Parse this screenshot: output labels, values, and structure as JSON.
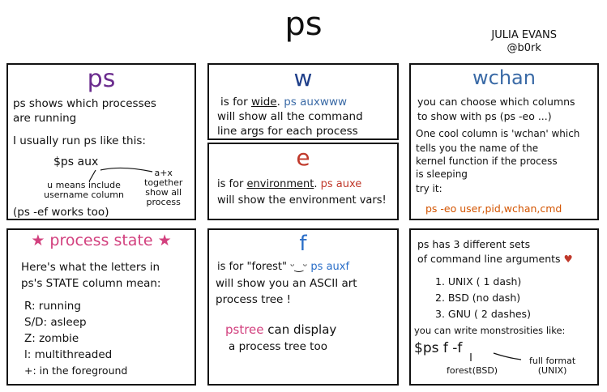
{
  "title": "ps",
  "author": {
    "name": "JULIA EVANS",
    "handle": "@b0rk"
  },
  "colors": {
    "purple": "#6b2c8e",
    "navy": "#1f3f8a",
    "red": "#c0392b",
    "pink": "#d2407e",
    "blue": "#2a6ec8",
    "orange": "#d35400"
  },
  "panel_ps": {
    "title": "ps",
    "line1": "ps shows which processes",
    "line2": "are running",
    "line3": "I usually run ps like this:",
    "command": "$ps aux",
    "note_u_1": "u means include",
    "note_u_2": "username column",
    "note_ax_1": "a+x",
    "note_ax_2": "together",
    "note_ax_3": "show all",
    "note_ax_4": "process",
    "footer": "(ps -ef works too)"
  },
  "panel_w": {
    "title": "w",
    "line1_pre": "is for ",
    "line1_word": "wide",
    "line1_post": ".",
    "line1_cmd": "ps auxwww",
    "line2": "will show all the command",
    "line3": "line args for each process"
  },
  "panel_e": {
    "title": "e",
    "line1_pre": "is for ",
    "line1_word": "environment",
    "line1_post": ".",
    "line1_cmd": "ps auxe",
    "line2": "will show the environment vars!"
  },
  "panel_wchan": {
    "title": "wchan",
    "line1": "you can choose which columns",
    "line2": "to show with ps (ps -eo ...)",
    "line3": "One cool column is 'wchan' which",
    "line4": "tells you the name of the",
    "line5": "kernel function if the process",
    "line6": "is sleeping",
    "line7": "try it:",
    "command": "ps -eo user,pid,wchan,cmd"
  },
  "panel_state": {
    "title": "process state",
    "star": "★",
    "line1": "Here's what the letters in",
    "line2": "ps's STATE column mean:",
    "states": [
      "R: running",
      "S/D: asleep",
      "Z: zombie",
      "l: multithreaded",
      "+: in the foreground"
    ]
  },
  "panel_f": {
    "title": "f",
    "line1_pre": "is for \"forest\" ",
    "smiley": "ᵕ‿ᵕ",
    "line1_cmd": "ps auxf",
    "line2": "will show you an ASCII art",
    "line3": "process tree !",
    "pstree": "pstree",
    "pstree_post": "can display",
    "line5": "a process tree too"
  },
  "panel_args": {
    "line1": "ps has 3 different sets",
    "line2": "of command line arguments",
    "heart": "♥",
    "list": [
      "1. UNIX ( 1 dash)",
      "2. BSD (no dash)",
      "3. GNU ( 2 dashes)"
    ],
    "line6": "you can write monstrosities like:",
    "command": "$ps f -f",
    "label_forest": "forest(BSD)",
    "label_full_1": "full format",
    "label_full_2": "(UNIX)"
  }
}
